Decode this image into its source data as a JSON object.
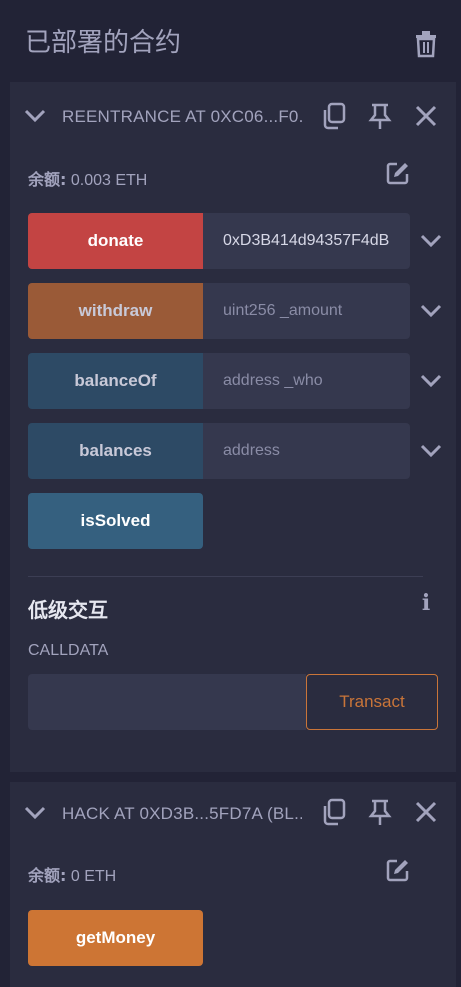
{
  "header": {
    "title": "已部署的合约"
  },
  "contracts": [
    {
      "title": "REENTRANCE AT 0XC06...F0...",
      "balance_label": "余额:",
      "balance_value": " 0.003 ETH",
      "functions": [
        {
          "name": "donate",
          "input_value": "0xD3B414d94357F4dB",
          "placeholder": "",
          "color": "#c34443"
        },
        {
          "name": "withdraw",
          "input_value": "",
          "placeholder": "uint256 _amount",
          "color": "#9a5a37"
        },
        {
          "name": "balanceOf",
          "input_value": "",
          "placeholder": "address _who",
          "color": "#2d4a65"
        },
        {
          "name": "balances",
          "input_value": "",
          "placeholder": "address",
          "color": "#2d4a65"
        },
        {
          "name": "isSolved",
          "color": "#35607f"
        }
      ],
      "low_level": {
        "title": "低级交互",
        "calldata_label": "CALLDATA",
        "transact_label": "Transact"
      }
    },
    {
      "title": "HACK AT 0XD3B...5FD7A (BL...",
      "balance_label": "余额:",
      "balance_value": " 0 ETH",
      "functions": [
        {
          "name": "getMoney",
          "color": "#cd7534"
        }
      ]
    }
  ],
  "colors": {
    "background": "#222336",
    "panel": "#2a2c3f",
    "input": "#35384e",
    "accent_orange": "#c97539",
    "text": "#a2a3bd"
  }
}
